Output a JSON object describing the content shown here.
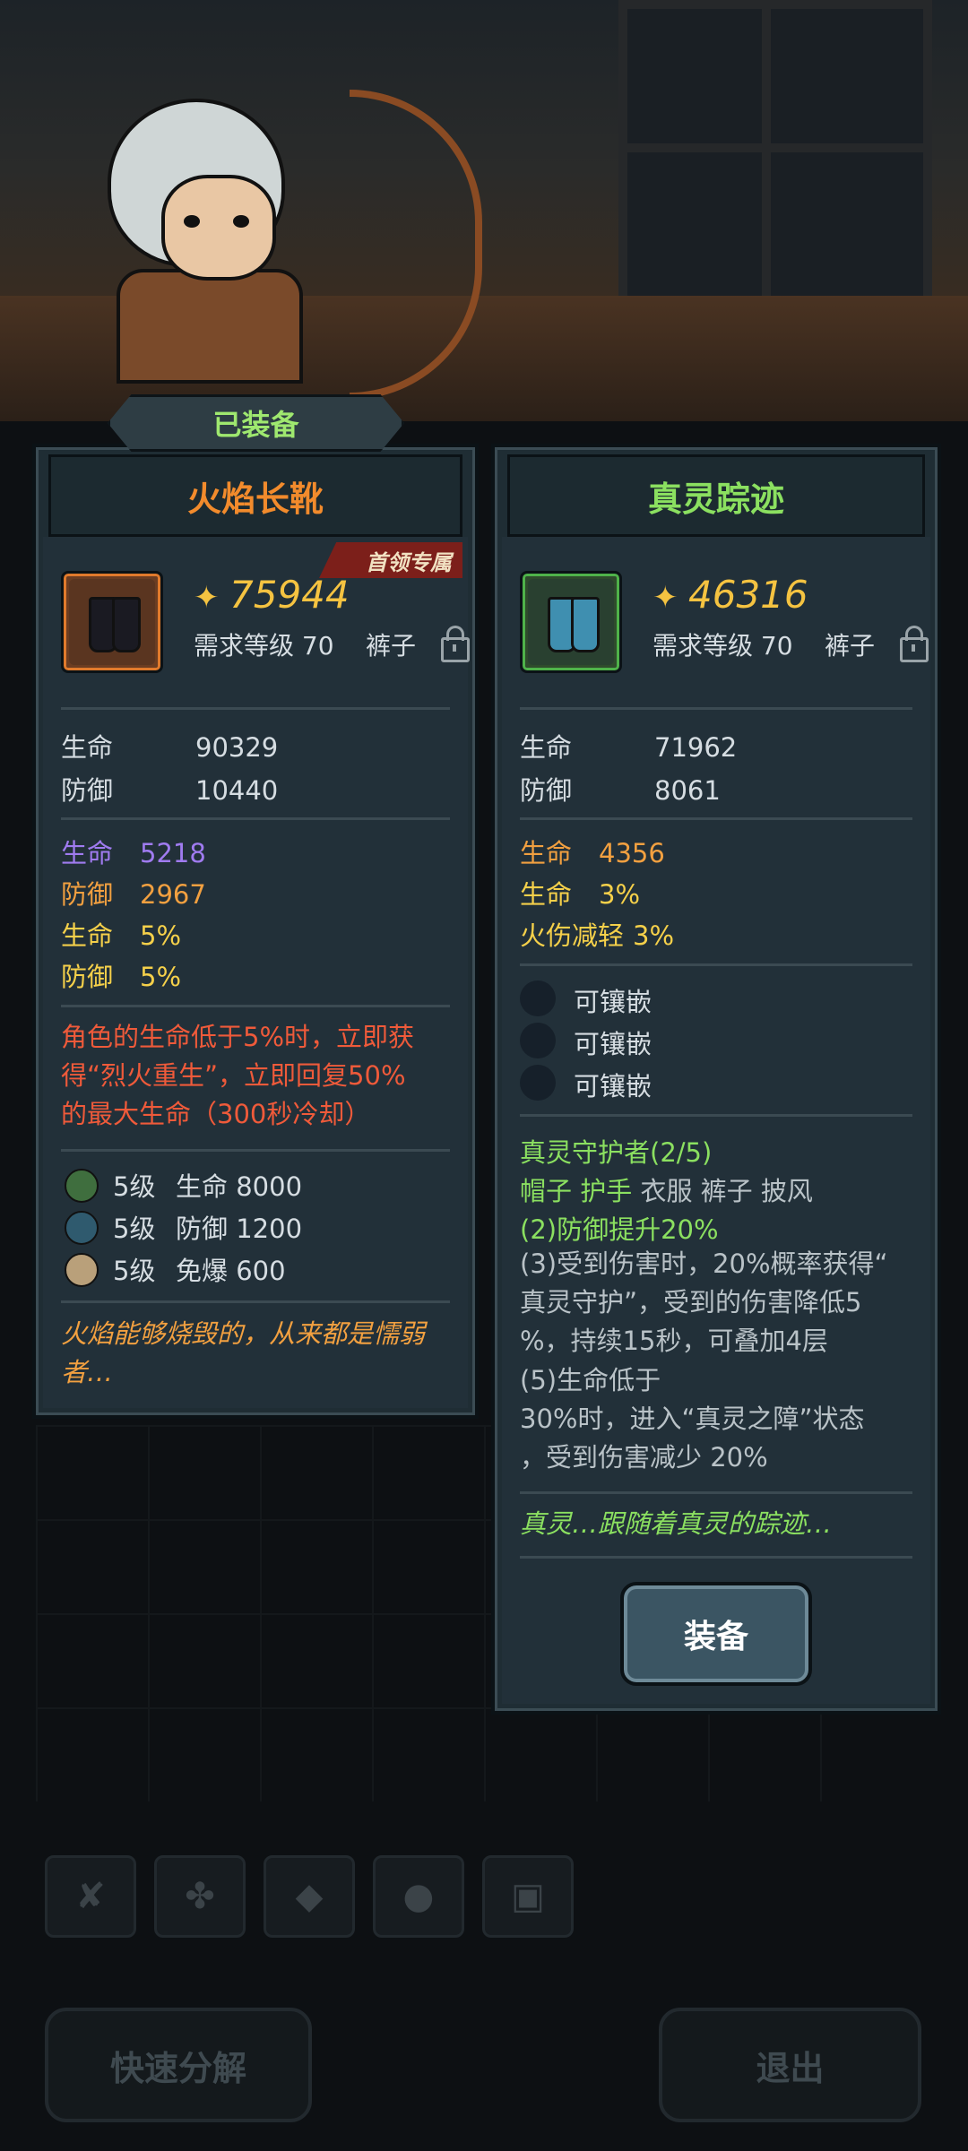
{
  "equipped_label": "已装备",
  "left_item": {
    "name": "火焰长靴",
    "name_color": "#f28b2c",
    "boss_tag": "首领专属",
    "power": "75944",
    "required_level": "需求等级 70",
    "slot": "裤子",
    "base_stats": [
      {
        "label": "生命",
        "value": "90329"
      },
      {
        "label": "防御",
        "value": "10440"
      }
    ],
    "extra_stats": [
      {
        "label": "生命",
        "value": "5218"
      },
      {
        "label": "防御",
        "value": "2967"
      },
      {
        "label": "生命",
        "value": "5%"
      },
      {
        "label": "防御",
        "value": "5%"
      }
    ],
    "special_desc": [
      "角色的生命低于5%时，立即获",
      "得“烈火重生”，立即回复50%",
      "的最大生命（300秒冷却）"
    ],
    "gems": [
      {
        "level": "5级",
        "stat": "生命 8000"
      },
      {
        "level": "5级",
        "stat": "防御 1200"
      },
      {
        "level": "5级",
        "stat": "免爆 600"
      }
    ],
    "flavor": [
      "火焰能够烧毁的，从来都是懦弱",
      "者…"
    ]
  },
  "right_item": {
    "name": "真灵踪迹",
    "name_color": "#8be060",
    "power": "46316",
    "required_level": "需求等级 70",
    "slot": "裤子",
    "base_stats": [
      {
        "label": "生命",
        "value": "71962"
      },
      {
        "label": "防御",
        "value": "8061"
      }
    ],
    "extra_stats": [
      {
        "label": "生命",
        "value": "4356"
      },
      {
        "label": "生命",
        "value": "3%"
      },
      {
        "label": "火伤减轻",
        "value": "3%"
      }
    ],
    "sockets": [
      "可镶嵌",
      "可镶嵌",
      "可镶嵌"
    ],
    "set_name": "真灵守护者(2/5)",
    "set_pieces_active": "帽子 护手",
    "set_pieces_inactive": "衣服 裤子 披风",
    "set_bonus_2": "(2)防御提升20%",
    "set_bonus_3": [
      "(3)受到伤害时，20%概率获得“",
      "真灵守护”，受到的伤害降低5",
      "%，持续15秒，可叠加4层"
    ],
    "set_bonus_5": [
      "(5)生命低于",
      "30%时，进入“真灵之障”状态",
      "，受到伤害减少 20%"
    ],
    "flavor": "真灵…跟随着真灵的踪迹…",
    "equip_button": "装备"
  },
  "bottom": {
    "tab_icons": [
      "weapon-icon",
      "paw-icon",
      "gem-icon",
      "stone-icon",
      "chest-icon"
    ],
    "decompose_button": "快速分解",
    "exit_button": "退出"
  }
}
